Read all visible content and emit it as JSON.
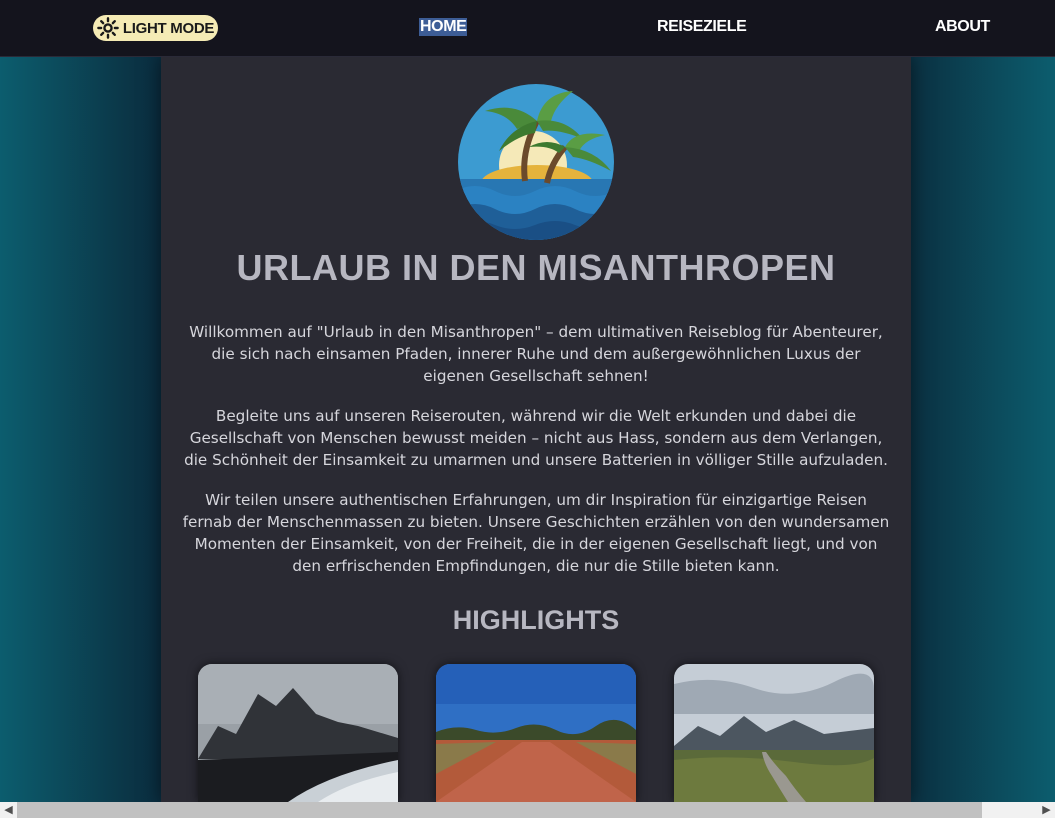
{
  "nav": {
    "mode_label": "Light Mode",
    "mode_icon": "sun-icon",
    "links": [
      {
        "label": "Home",
        "active": true
      },
      {
        "label": "Reiseziele",
        "active": false
      },
      {
        "label": "About",
        "active": false
      }
    ]
  },
  "main": {
    "logo_icon": "palm-island-icon",
    "title": "Urlaub in den Misanthropen",
    "paragraphs": [
      "Willkommen auf \"Urlaub in den Misanthropen\" – dem ultimativen Reiseblog für Abenteurer, die sich nach einsamen Pfaden, innerer Ruhe und dem außergewöhnlichen Luxus der eigenen Gesellschaft sehnen!",
      "Begleite uns auf unseren Reiserouten, während wir die Welt erkunden und dabei die Gesellschaft von Menschen bewusst meiden – nicht aus Hass, sondern aus dem Verlangen, die Schönheit der Einsamkeit zu umarmen und unsere Batterien in völliger Stille aufzuladen.",
      "Wir teilen unsere authentischen Erfahrungen, um dir Inspiration für einzigartige Reisen fernab der Menschenmassen zu bieten. Unsere Geschichten erzählen von den wundersamen Momenten der Einsamkeit, von der Freiheit, die in der eigenen Gesellschaft liegt, und von den erfrischenden Empfindungen, die nur die Stille bieten kann."
    ],
    "highlights_title": "Highlights",
    "highlight_cards": [
      {
        "image": "black-sand-beach-mountains-photo"
      },
      {
        "image": "red-outback-road-photo"
      },
      {
        "image": "highland-hiking-trail-photo"
      }
    ]
  },
  "colors": {
    "topbar": "#14141d",
    "mode_button": "#f5ebb5",
    "active_nav": "#3d5d96",
    "panel": "#2a2a33",
    "heading": "#b7b7c1",
    "body_text": "#d6d6dc"
  }
}
